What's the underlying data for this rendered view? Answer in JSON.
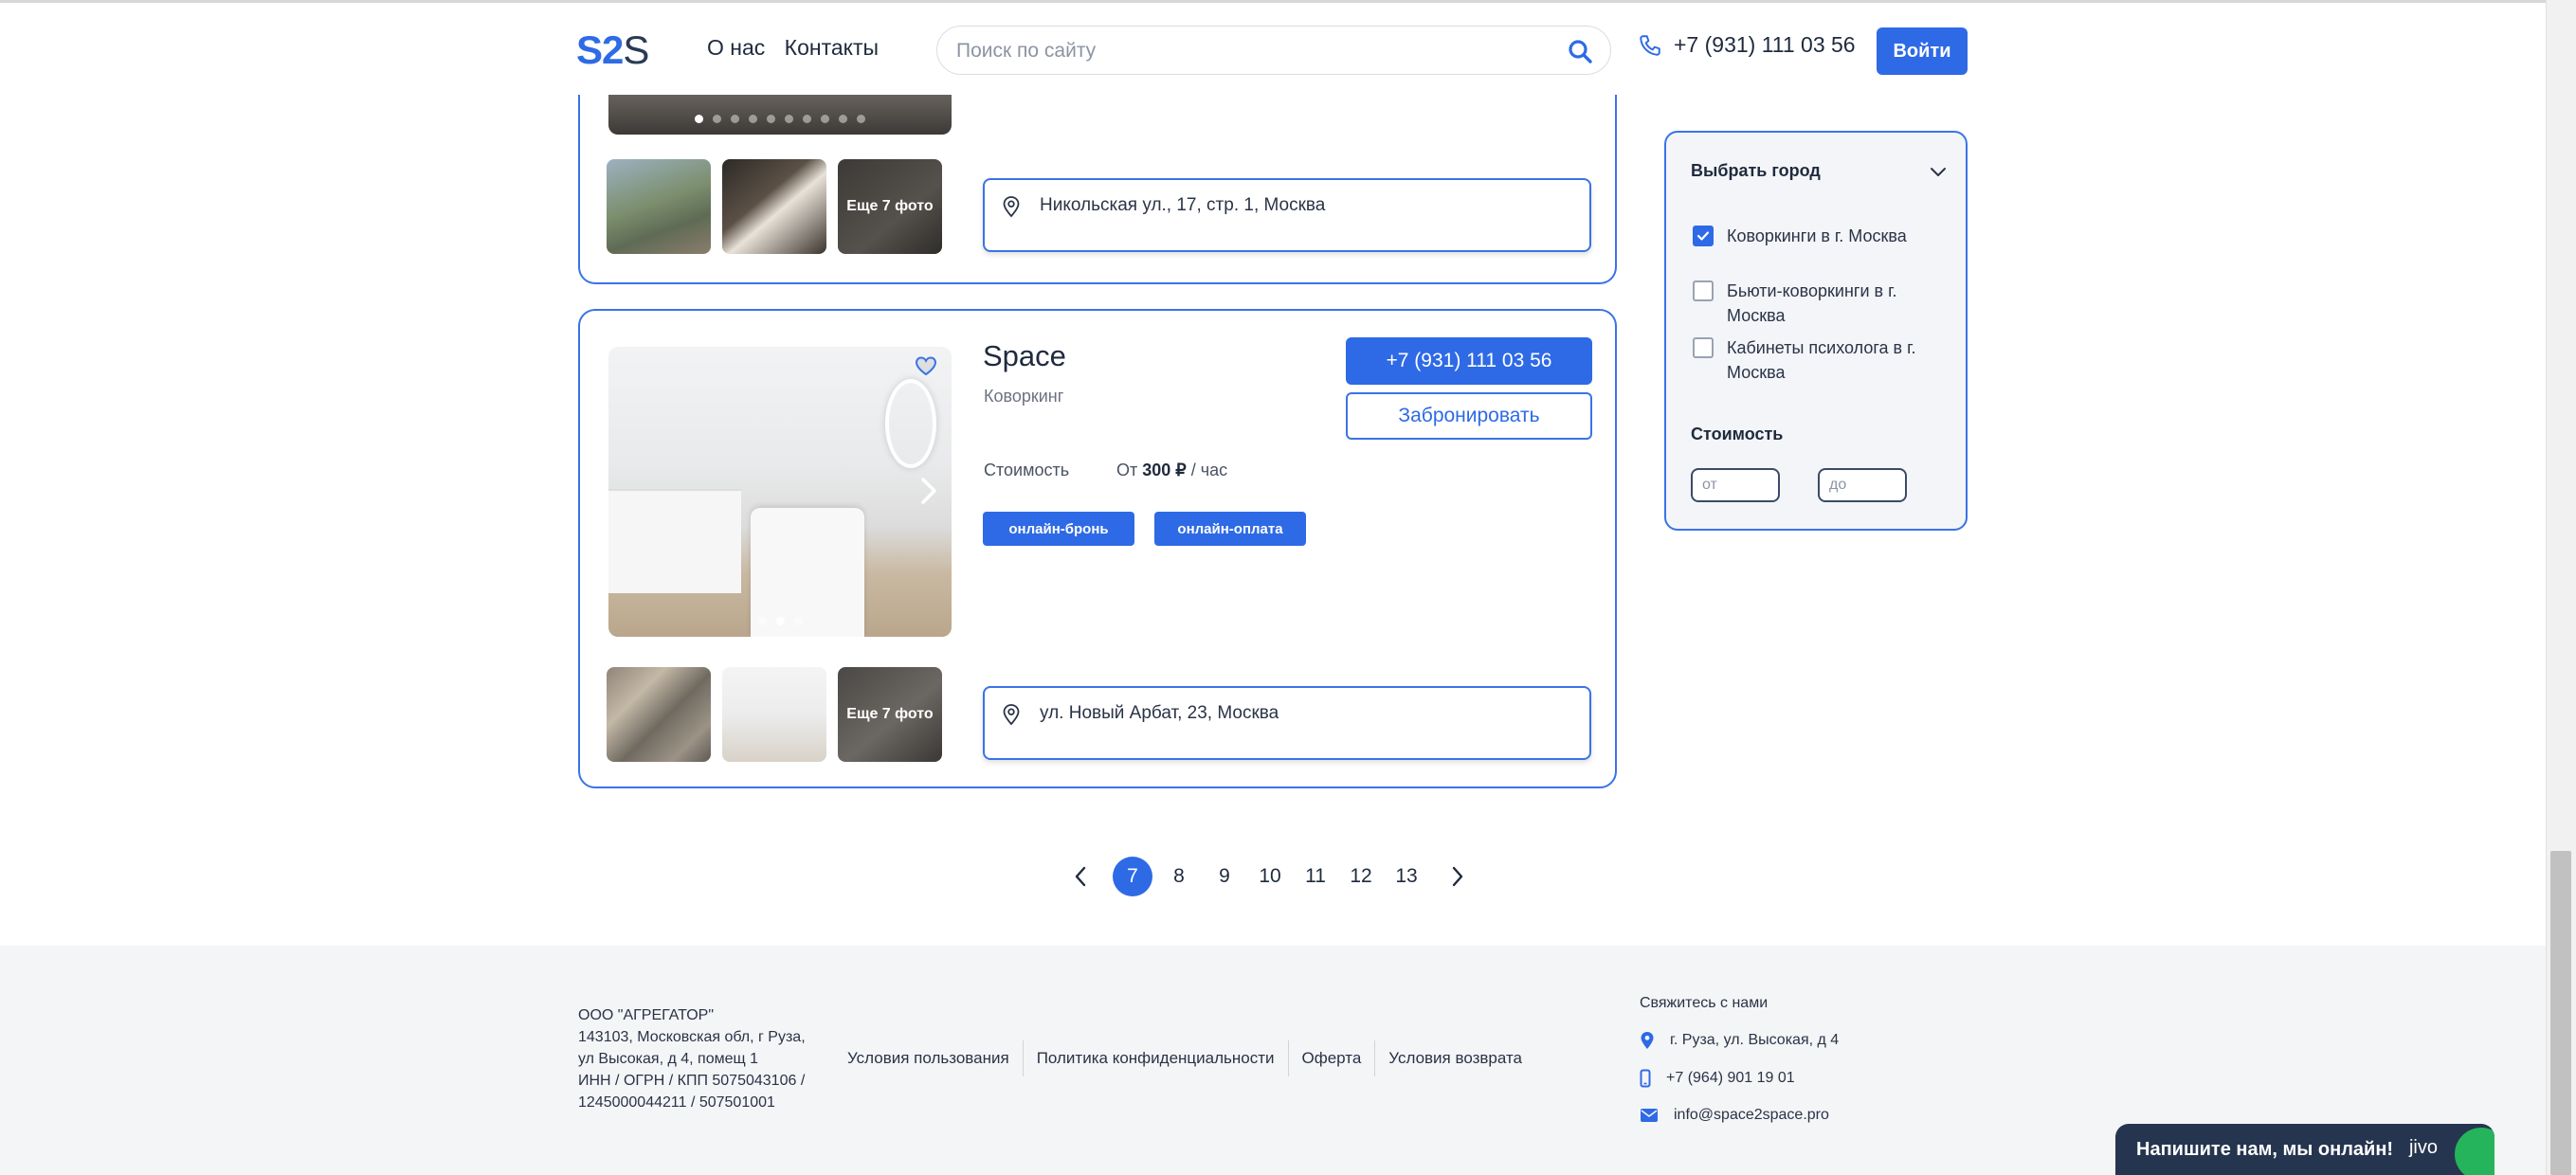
{
  "header": {
    "logo_a": "S2",
    "logo_b": "S",
    "nav": [
      "О нас",
      "Контакты"
    ],
    "search_placeholder": "Поиск по сайту",
    "phone": "+7 (931) 111 03 56",
    "login": "Войти"
  },
  "listings": [
    {
      "address": "Никольская ул., 17, стр. 1, Москва",
      "more_photos": "Еще 7 фото",
      "dots": 10,
      "active_dot": 1
    },
    {
      "title": "Space",
      "type": "Коворкинг",
      "price_label": "Стоимость",
      "price_prefix": "От",
      "price_value": "300 ₽",
      "price_unit": "/ час",
      "tags": [
        "онлайн-бронь",
        "онлайн-оплата"
      ],
      "phone_button": "+7 (931) 111 03 56",
      "book_button": "Забронировать",
      "address": "ул. Новый Арбат, 23, Москва",
      "more_photos": "Еще 7 фото",
      "dots": 3,
      "active_dot": 2
    }
  ],
  "filter": {
    "title": "Выбрать город",
    "options": [
      {
        "label": "Коворкинги в г. Москва",
        "checked": true
      },
      {
        "label": "Бьюти-коворкинги в г. Москва",
        "checked": false
      },
      {
        "label": "Кабинеты психолога в г. Москва",
        "checked": false
      }
    ],
    "cost_title": "Стоимость",
    "from_placeholder": "от",
    "to_placeholder": "до"
  },
  "pagination": {
    "pages": [
      "7",
      "8",
      "9",
      "10",
      "11",
      "12",
      "13"
    ],
    "current": "7"
  },
  "footer": {
    "company_lines": [
      "ООО \"АГРЕГАТОР\"",
      "143103, Московская обл, г Руза,",
      "ул Высокая, д 4, помещ 1",
      "ИНН / ОГРН / КПП 5075043106 /",
      "1245000044211 / 507501001"
    ],
    "links": [
      "Условия пользования",
      "Политика конфиденциальности",
      "Оферта",
      "Условия возврата"
    ],
    "contact_title": "Свяжитесь с нами",
    "address": "г. Руза, ул. Высокая, д 4",
    "phone": "+7 (964) 901 19 01",
    "email": "info@space2space.pro"
  },
  "chat": {
    "label": "Напишите нам, мы онлайн!",
    "brand": "jivo"
  },
  "colors": {
    "accent": "#2e6ae6",
    "footer_bg": "#f4f5f7",
    "chat_bg": "#26354f",
    "chat_leaf": "#25b45b"
  }
}
